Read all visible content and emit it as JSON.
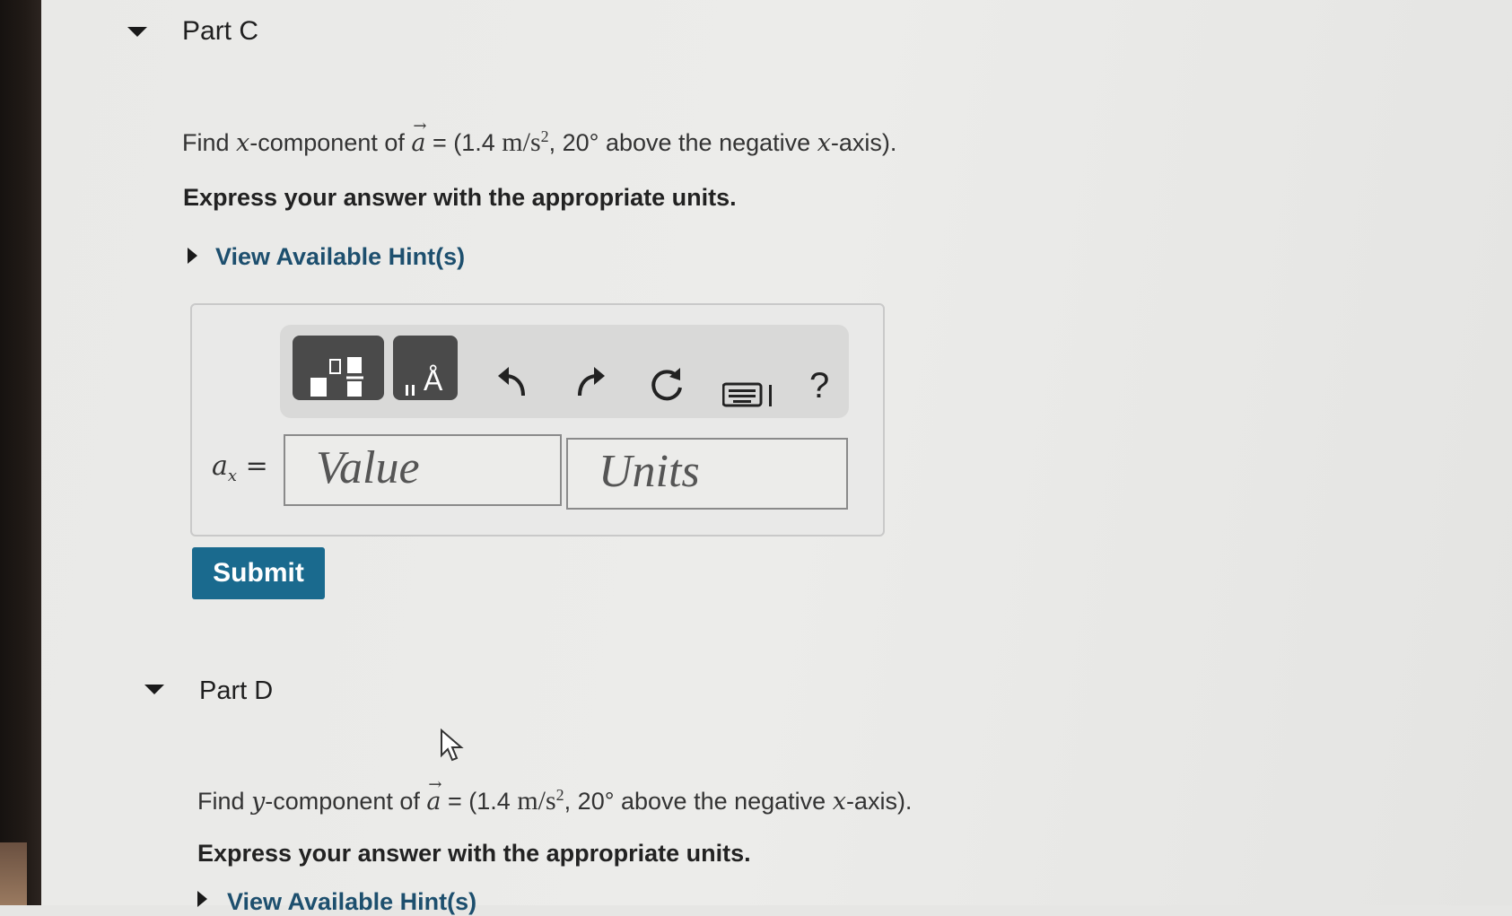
{
  "partC": {
    "title": "Part C",
    "question_prefix": "Find ",
    "question_var": "x",
    "question_mid": "-component of ",
    "vector": "a",
    "question_eq": " = (1.4 ",
    "question_unit": "m/s",
    "question_exp": "2",
    "question_angle": ", 20° above the negative ",
    "question_axis": "x",
    "question_suffix": "-axis).",
    "instruction": "Express your answer with the appropriate units.",
    "hint_link": "View Available Hint(s)",
    "answer_label_var": "a",
    "answer_label_sub": "x",
    "answer_label_eq": " =",
    "value_placeholder": "Value",
    "units_placeholder": "Units",
    "submit_label": "Submit",
    "toolbar": {
      "templates_icon": "templates-icon",
      "units_icon": "units-icon",
      "units_glyph": "Å",
      "undo_icon": "undo-icon",
      "redo_icon": "redo-icon",
      "reset_icon": "reset-icon",
      "keyboard_icon": "keyboard-icon",
      "help_icon": "help-icon",
      "help_glyph": "?"
    }
  },
  "partD": {
    "title": "Part D",
    "question_prefix": "Find ",
    "question_var": "y",
    "question_mid": "-component of ",
    "vector": "a",
    "question_eq": " = (1.4 ",
    "question_unit": "m/s",
    "question_exp": "2",
    "question_angle": ", 20° above the negative ",
    "question_axis": "x",
    "question_suffix": "-axis).",
    "instruction": "Express your answer with the appropriate units.",
    "hint_link": "View Available Hint(s)"
  },
  "colors": {
    "submit_bg": "#1a6a8e",
    "hint_link": "#1d4f6e",
    "page_bg": "#e9e9e7"
  }
}
